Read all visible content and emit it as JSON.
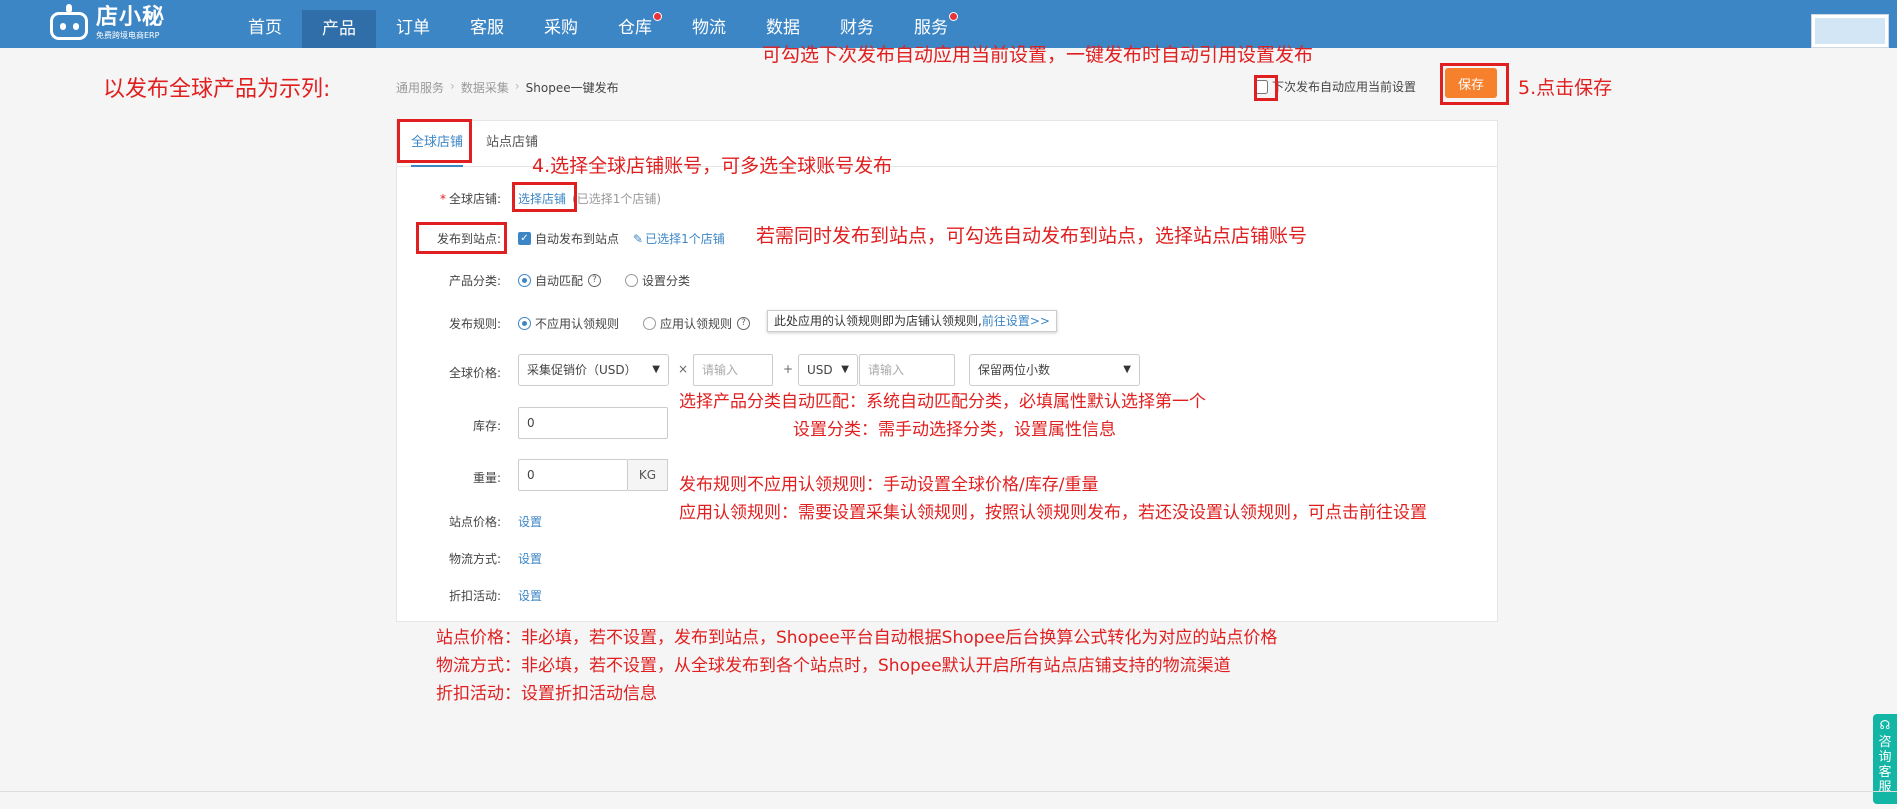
{
  "brand": {
    "name": "店小秘",
    "tagline": "免费跨境电商ERP"
  },
  "nav": [
    {
      "label": "首页",
      "dot": false
    },
    {
      "label": "产品",
      "dot": false,
      "active": true
    },
    {
      "label": "订单",
      "dot": false
    },
    {
      "label": "客服",
      "dot": false
    },
    {
      "label": "采购",
      "dot": false
    },
    {
      "label": "仓库",
      "dot": true
    },
    {
      "label": "物流",
      "dot": false
    },
    {
      "label": "数据",
      "dot": false
    },
    {
      "label": "财务",
      "dot": false
    },
    {
      "label": "服务",
      "dot": true
    }
  ],
  "breadcrumb": {
    "items": [
      "通用服务",
      "数据采集"
    ],
    "current": "Shopee一键发布"
  },
  "header": {
    "remember_label": "下次发布自动应用当前设置",
    "save_label": "保存"
  },
  "tabs": [
    "全球店铺",
    "站点店铺"
  ],
  "form": {
    "global_store": {
      "label": "全球店铺:",
      "link": "选择店铺",
      "note": "(已选择1个店铺)"
    },
    "publish_site": {
      "label": "发布到站点:",
      "checkbox_label": "自动发布到站点",
      "link": "已选择1个店铺"
    },
    "category": {
      "label": "产品分类:",
      "option_auto": "自动匹配",
      "option_manual": "设置分类"
    },
    "rule": {
      "label": "发布规则:",
      "option_none": "不应用认领规则",
      "option_apply": "应用认领规则",
      "tooltip_text": "此处应用的认领规则即为店铺认领规则,",
      "tooltip_link": "前往设置>>"
    },
    "price": {
      "label": "全球价格:",
      "source_select": "采集促销价（USD）",
      "multiply": "×",
      "factor_placeholder": "请输入",
      "plus": "+",
      "currency": "USD",
      "add_placeholder": "请输入",
      "decimal_select": "保留两位小数"
    },
    "stock": {
      "label": "库存:",
      "value": "0"
    },
    "weight": {
      "label": "重量:",
      "value": "0",
      "unit": "KG"
    },
    "site_price": {
      "label": "站点价格:",
      "link": "设置"
    },
    "logistics": {
      "label": "物流方式:",
      "link": "设置"
    },
    "discount": {
      "label": "折扣活动:",
      "link": "设置"
    }
  },
  "annotations": {
    "title": "以发布全球产品为示列:",
    "remember_note": "可勾选下次发布自动应用当前设置，一键发布时自动引用设置发布",
    "save_note": "5.点击保存",
    "store_note": "4.选择全球店铺账号，可多选全球账号发布",
    "site_note": "若需同时发布到站点，可勾选自动发布到站点，选择站点店铺账号",
    "category_note_1": "选择产品分类自动匹配：系统自动匹配分类，必填属性默认选择第一个",
    "category_note_2": "设置分类：需手动选择分类，设置属性信息",
    "rule_note_1": "发布规则不应用认领规则：手动设置全球价格/库存/重量",
    "rule_note_2": "应用认领规则：需要设置采集认领规则，按照认领规则发布，若还没设置认领规则，可点击前往设置",
    "site_price_note": "站点价格：非必填，若不设置，发布到站点，Shopee平台自动根据Shopee后台换算公式转化为对应的站点价格",
    "logistics_note": "物流方式：非必填，若不设置，从全球发布到各个站点时，Shopee默认开启所有站点店铺支持的物流渠道",
    "discount_note": "折扣活动：设置折扣活动信息"
  },
  "consult": {
    "label": "咨询客服"
  },
  "colors": {
    "nav_bg": "#3d86c6",
    "accent": "#3d86c6",
    "save_btn": "#f6802b",
    "annotation": "#e02020",
    "consult": "#13b6a4"
  }
}
